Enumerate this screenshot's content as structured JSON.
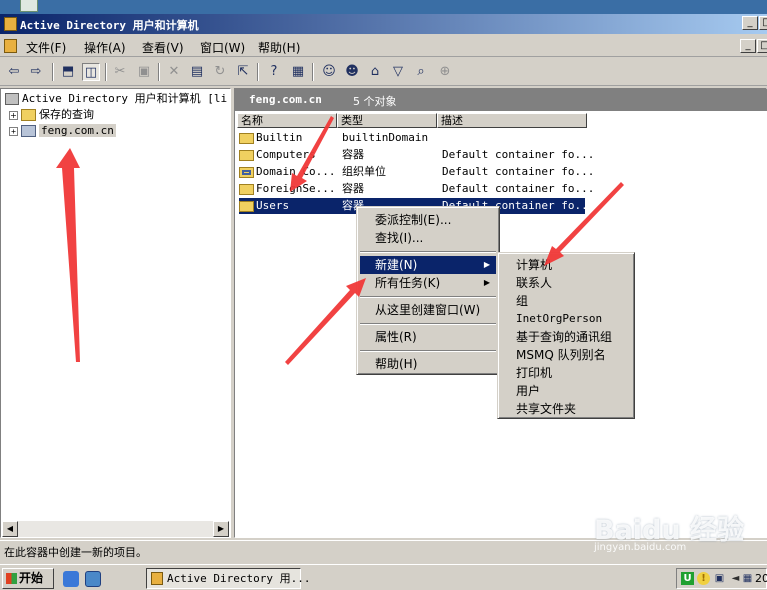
{
  "window": {
    "title": "Active Directory 用户和计算机",
    "controls": {
      "minimize": "_",
      "maximize": "□",
      "close": "×"
    }
  },
  "menubar": {
    "items": [
      "文件(F)",
      "操作(A)",
      "查看(V)",
      "窗口(W)",
      "帮助(H)"
    ]
  },
  "toolbar": {
    "icons": [
      "back-arrow-icon",
      "forward-arrow-icon",
      "up-folder-icon",
      "show-hide-tree-icon",
      "cut-icon",
      "copy-icon",
      "delete-icon",
      "properties-icon",
      "refresh-icon",
      "export-icon",
      "help-icon",
      "console-tree-icon",
      "new-user-icon",
      "new-group-icon",
      "new-ou-icon",
      "filter-icon",
      "find-icon",
      "add-group-icon"
    ]
  },
  "tree": {
    "root": "Active Directory 用户和计算机 [li",
    "items": [
      {
        "label": "保存的查询",
        "icon": "folder-icon"
      },
      {
        "label": "feng.com.cn",
        "icon": "domain-icon",
        "selected": true
      }
    ]
  },
  "details": {
    "header_domain": "feng.com.cn",
    "header_count": "5 个对象",
    "columns": [
      "名称",
      "类型",
      "描述"
    ],
    "rows": [
      {
        "name": "Builtin",
        "type": "builtinDomain",
        "desc": ""
      },
      {
        "name": "Computers",
        "type": "容器",
        "desc": "Default container fo..."
      },
      {
        "name": "Domain Co...",
        "type": "组织单位",
        "desc": "Default container fo..."
      },
      {
        "name": "ForeignSe...",
        "type": "容器",
        "desc": "Default container fo..."
      },
      {
        "name": "Users",
        "type": "容器",
        "desc": "Default container fo..."
      }
    ]
  },
  "context_menu": {
    "items": [
      "委派控制(E)...",
      "查找(I)...",
      "新建(N)",
      "所有任务(K)",
      "从这里创建窗口(W)",
      "属性(R)",
      "帮助(H)"
    ]
  },
  "submenu_new": {
    "items": [
      "计算机",
      "联系人",
      "组",
      "InetOrgPerson",
      "基于查询的通讯组",
      "MSMQ 队列别名",
      "打印机",
      "用户",
      "共享文件夹"
    ]
  },
  "statusbar": {
    "text": "在此容器中创建一新的项目。"
  },
  "taskbar": {
    "start": "开始",
    "task": "Active Directory 用...",
    "clock": "20"
  },
  "watermark": {
    "logo": "Baidu 经验",
    "url": "jingyan.baidu.com"
  },
  "colors": {
    "title_gradient_start": "#0a246a",
    "title_gradient_end": "#a6caf0",
    "selection": "#0a246a",
    "window_face": "#d4d0c8",
    "annotation_arrow": "#f03030"
  }
}
